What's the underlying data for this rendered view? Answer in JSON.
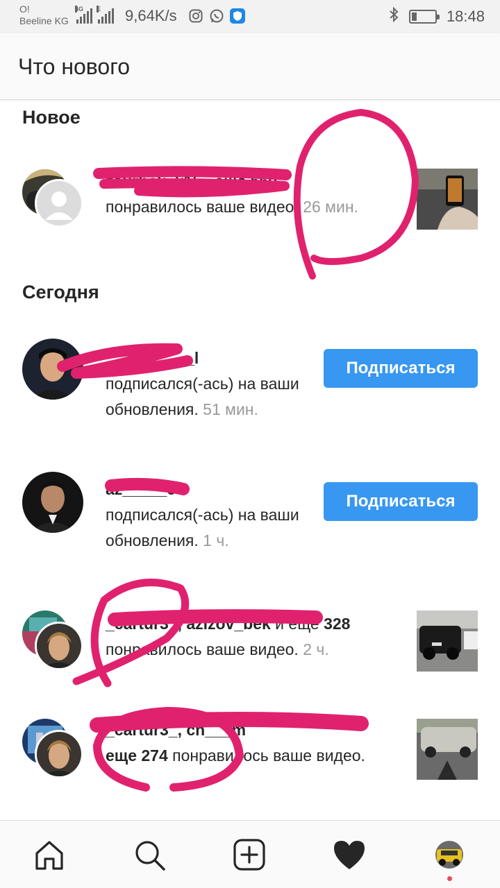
{
  "status_bar": {
    "carrier_line1": "O!",
    "carrier_line2": "Beeline KG",
    "signal1_label": "4G",
    "signal2_label": "E",
    "net_speed": "9,64K/s",
    "time": "18:48",
    "battery_level": 0.22,
    "icons": [
      "signal-icon",
      "instagram-icon",
      "whatsapp-icon",
      "shield-app-icon",
      "bluetooth-icon",
      "battery-icon"
    ]
  },
  "header": {
    "title": "Что нового"
  },
  "sections": {
    "new_title": "Новое",
    "today_title": "Сегодня"
  },
  "notifications": [
    {
      "username": "zaurbek_k15_",
      "bold_suffix": "еще 560",
      "text": "понравилось ваше видео.",
      "time": "26 мин."
    },
    {
      "username": "__________l",
      "text": "подписался(-ась) на ваши обновления.",
      "time": "51 мин.",
      "button": "Подписаться"
    },
    {
      "username": "az_____e",
      "text": "подписался(-ась) на ваши обновления.",
      "time": "1 ч.",
      "button": "Подписаться"
    },
    {
      "username": "_cartur3_, azizov_bek",
      "middle": " и еще ",
      "bold_count": "328",
      "text": " понравилось ваше видео.",
      "time": "2 ч."
    },
    {
      "username": "_cartur3_, ch___m",
      "bold_count": "еще 274",
      "text": " понравилось ваше видео."
    }
  ],
  "bottom_nav": {
    "items": [
      "home-icon",
      "search-icon",
      "new-post-icon",
      "activity-heart-icon",
      "profile-avatar"
    ],
    "accent": "#262626",
    "badge_color": "#ed4956"
  },
  "colors": {
    "follow_button": "#3897f0",
    "scribble": "#e0226e"
  }
}
